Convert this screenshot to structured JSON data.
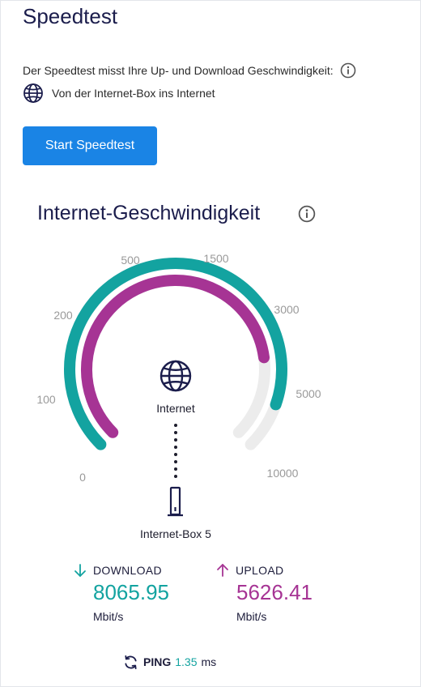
{
  "speedtest": {
    "title": "Speedtest",
    "description": "Der Speedtest misst Ihre Up- und Download Geschwindigkeit:",
    "route_label": "Von der Internet-Box ins Internet",
    "start_button_label": "Start Speedtest"
  },
  "speed": {
    "section_title": "Internet-Geschwindigkeit",
    "scale_labels": [
      "0",
      "100",
      "200",
      "500",
      "1500",
      "3000",
      "5000",
      "10000"
    ],
    "internet_label": "Internet",
    "box_label": "Internet-Box 5",
    "download": {
      "label": "DOWNLOAD",
      "value": "8065.95",
      "unit": "Mbit/s",
      "gauge_level": 0.905
    },
    "upload": {
      "label": "UPLOAD",
      "value": "5626.41",
      "unit": "Mbit/s",
      "gauge_level": 0.805
    },
    "ping": {
      "label": "PING",
      "value": "1.35",
      "unit": "ms"
    }
  },
  "colors": {
    "accent_blue": "#1a84e5",
    "download_teal": "#13a3a0",
    "upload_purple": "#a63494",
    "gauge_track": "#ececec",
    "navy": "#1b1d4c"
  },
  "icons": {
    "info": "info-icon",
    "globe": "globe-icon",
    "router": "router-icon",
    "download_arrow": "arrow-down-icon",
    "upload_arrow": "arrow-up-icon",
    "refresh": "refresh-icon"
  }
}
